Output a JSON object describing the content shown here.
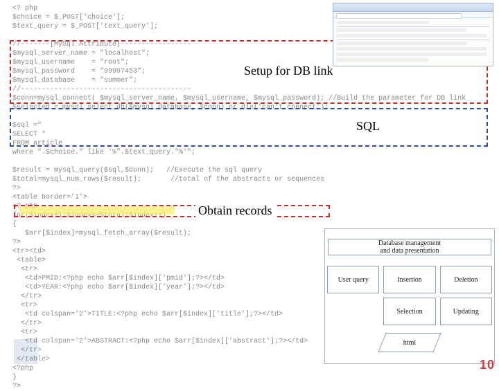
{
  "labels": {
    "setup": "Setup for DB link",
    "sql": "SQL",
    "records": "Obtain records"
  },
  "code": {
    "line1": "<? php",
    "line2": "$choice = $_POST['choice'];",
    "line3": "$text_query = $_POST['text_query'];",
    "line4": "",
    "line5": "//-------[MySql Attribute]-----------------",
    "line6": "$mysql_server_name = \"localhost\";",
    "line7": "$mysql_username    = \"root\";",
    "line8": "$mysql_password    = \"99997453\";",
    "line9": "$mysql_database    = \"summer\";",
    "line10": "//-----------------------------------------",
    "line11": "$conn=mysql_connect( $mysql_server_name, $mysql_username, $mysql_password); //Build the parameter for DB link",
    "line12": "$selected = mysql_select_db($mysql_database, $conn) or die('can't connect');",
    "line13": "",
    "line14": "$sql =\"",
    "line15": "SELECT *",
    "line16": "FROM article",
    "line17": "where \".$choice.\" like '%\".$text_query.\"%'\";",
    "line18": "",
    "line19": "$result = mysql_query($sql,$conn);   //Execute the sql query",
    "line20": "$total=mysql_num_rows($result);       //total of the abstracts or sequences",
    "line21": "?>",
    "line22": "<table border='1'>",
    "line23": "<? php",
    "line24": "for($index=1;$index<=$total;$index++)",
    "line25": "{",
    "line26": "   $arr[$index]=mysql_fetch_array($result);",
    "line27": "?>",
    "line28": "<tr><td>",
    "line29": " <table>",
    "line30": "  <tr>",
    "line31": "   <td>PMID:<?php echo $arr[$index]['pmid'];?></td>",
    "line32": "   <td>YEAR:<?php echo $arr[$index]['year'];?></td>",
    "line33": "  </tr>",
    "line34": "  <tr>",
    "line35": "   <td colspan='2'>TITLE:<?php echo $arr[$index]['title'];?></td>",
    "line36": "  </tr>",
    "line37": "  <tr>",
    "line38": "   <td colspan='2'>ABSTRACT:<?php echo $arr[$index]['abstract'];?></td>",
    "line39": "  </tr>",
    "line40": " </table>",
    "line41": "<?php",
    "line42": "}",
    "line43": "?>"
  },
  "diagram": {
    "row1": "Database management\nand data presentation",
    "cells": {
      "uq": "User query",
      "ins": "Insertion",
      "del": "Deletion",
      "sel": "Selection",
      "upd": "Updating"
    },
    "shape": "html"
  },
  "page_number": "10"
}
